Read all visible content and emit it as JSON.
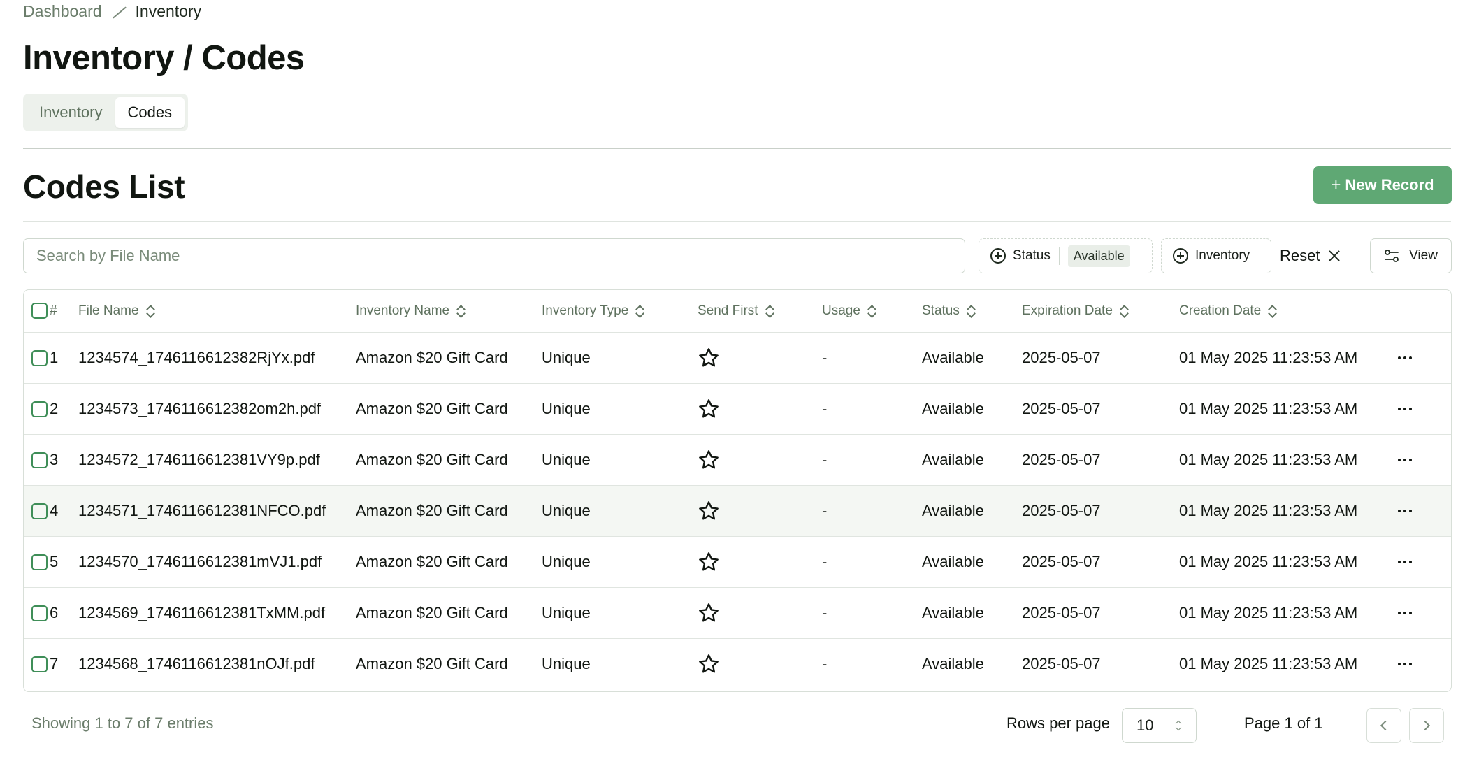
{
  "breadcrumb": {
    "items": [
      "Dashboard",
      "Inventory"
    ]
  },
  "page_title": "Inventory / Codes",
  "tabs": [
    {
      "label": "Inventory",
      "active": false
    },
    {
      "label": "Codes",
      "active": true
    }
  ],
  "section_title": "Codes List",
  "new_record": {
    "label": "New Record",
    "icon": "plus-icon"
  },
  "search": {
    "placeholder": "Search by File Name",
    "value": ""
  },
  "filters": {
    "status": {
      "label": "Status",
      "selected": "Available"
    },
    "inventory": {
      "label": "Inventory"
    }
  },
  "reset": {
    "label": "Reset"
  },
  "view": {
    "label": "View"
  },
  "table": {
    "columns": [
      "#",
      "File Name",
      "Inventory Name",
      "Inventory Type",
      "Send First",
      "Usage",
      "Status",
      "Expiration Date",
      "Creation Date"
    ],
    "rows": [
      {
        "num": "1",
        "file": "1234574_1746116612382RjYx.pdf",
        "inv_name": "Amazon $20 Gift Card",
        "inv_type": "Unique",
        "usage": "-",
        "status": "Available",
        "exp": "2025-05-07",
        "created": "01 May 2025 11:23:53 AM"
      },
      {
        "num": "2",
        "file": "1234573_1746116612382om2h.pdf",
        "inv_name": "Amazon $20 Gift Card",
        "inv_type": "Unique",
        "usage": "-",
        "status": "Available",
        "exp": "2025-05-07",
        "created": "01 May 2025 11:23:53 AM"
      },
      {
        "num": "3",
        "file": "1234572_1746116612381VY9p.pdf",
        "inv_name": "Amazon $20 Gift Card",
        "inv_type": "Unique",
        "usage": "-",
        "status": "Available",
        "exp": "2025-05-07",
        "created": "01 May 2025 11:23:53 AM"
      },
      {
        "num": "4",
        "file": "1234571_1746116612381NFCO.pdf",
        "inv_name": "Amazon $20 Gift Card",
        "inv_type": "Unique",
        "usage": "-",
        "status": "Available",
        "exp": "2025-05-07",
        "created": "01 May 2025 11:23:53 AM"
      },
      {
        "num": "5",
        "file": "1234570_1746116612381mVJ1.pdf",
        "inv_name": "Amazon $20 Gift Card",
        "inv_type": "Unique",
        "usage": "-",
        "status": "Available",
        "exp": "2025-05-07",
        "created": "01 May 2025 11:23:53 AM"
      },
      {
        "num": "6",
        "file": "1234569_1746116612381TxMM.pdf",
        "inv_name": "Amazon $20 Gift Card",
        "inv_type": "Unique",
        "usage": "-",
        "status": "Available",
        "exp": "2025-05-07",
        "created": "01 May 2025 11:23:53 AM"
      },
      {
        "num": "7",
        "file": "1234568_1746116612381nOJf.pdf",
        "inv_name": "Amazon $20 Gift Card",
        "inv_type": "Unique",
        "usage": "-",
        "status": "Available",
        "exp": "2025-05-07",
        "created": "01 May 2025 11:23:53 AM"
      }
    ]
  },
  "footer": {
    "showing": "Showing 1 to 7 of 7 entries",
    "rows_per_page_label": "Rows per page",
    "rows_per_page_value": "10",
    "page_info": "Page 1 of 1"
  },
  "colors": {
    "accent": "#5fa874",
    "checkbox": "#3f8e58",
    "muted_text": "#6b7d6b",
    "border": "#d8dfd8"
  },
  "icons": [
    "plus-icon",
    "plus-circle-icon",
    "close-icon",
    "sliders-icon",
    "sort-icon",
    "star-icon",
    "more-horizontal-icon",
    "chevron-left-icon",
    "chevron-right-icon",
    "chevron-up-down-icon"
  ]
}
